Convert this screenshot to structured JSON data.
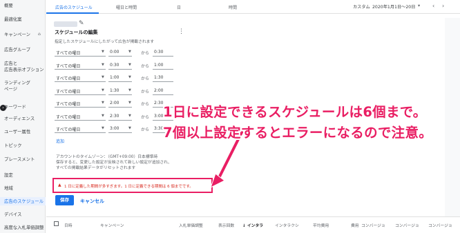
{
  "sidebar": {
    "items": [
      {
        "label": "概要",
        "active": false
      },
      {
        "label": "最適化案",
        "active": false
      },
      {
        "label": "キャンペーン",
        "active": false
      },
      {
        "label": "広告グループ",
        "active": false
      },
      {
        "label": "広告と",
        "active": false
      },
      {
        "label": "広告表示オプション",
        "active": false
      },
      {
        "label": "ランディング",
        "active": false
      },
      {
        "label": "ページ",
        "active": false
      },
      {
        "label": "キーワード",
        "active": false
      },
      {
        "label": "オーディエンス",
        "active": false
      },
      {
        "label": "ユーザー属性",
        "active": false
      },
      {
        "label": "トピック",
        "active": false
      },
      {
        "label": "プレースメント",
        "active": false
      },
      {
        "label": "設定",
        "active": false
      },
      {
        "label": "地域",
        "active": false
      },
      {
        "label": "広告のスケジュール",
        "active": true
      },
      {
        "label": "デバイス",
        "active": false
      },
      {
        "label": "高度な入札単価調整",
        "active": false
      }
    ]
  },
  "tabs": {
    "items": [
      "広告のスケジュール",
      "曜日と時間",
      "日",
      "時間"
    ],
    "active_index": 0
  },
  "date_range": {
    "label": "カスタム",
    "value": "2020年1月1日～20日",
    "caret": "▾",
    "prev": "‹",
    "next": "›"
  },
  "schedule_editor": {
    "title": "スケジュールの編集",
    "description": "指定したスケジュールにしたがって広告が掲載されます",
    "rows": [
      {
        "day": "すべての曜日",
        "start": "0:00",
        "sep": "から",
        "end": "0:30"
      },
      {
        "day": "すべての曜日",
        "start": "0:30",
        "sep": "から",
        "end": "1:00"
      },
      {
        "day": "すべての曜日",
        "start": "1:00",
        "sep": "から",
        "end": "1:30"
      },
      {
        "day": "すべての曜日",
        "start": "1:30",
        "sep": "から",
        "end": "2:00"
      },
      {
        "day": "すべての曜日",
        "start": "2:00",
        "sep": "から",
        "end": "2:30"
      },
      {
        "day": "すべての曜日",
        "start": "2:30",
        "sep": "から",
        "end": "3:00"
      },
      {
        "day": "すべての曜日",
        "start": "3:00",
        "sep": "から",
        "end": "3:30"
      }
    ],
    "add_link": "追加",
    "timezone_note": [
      "アカウントのタイムゾーン：（GMT+09:00）日本標準時",
      "保存すると、変更した設定が反映されて新しい設定が追加され、",
      "すべての掲載結果データがリセットされます"
    ],
    "error": "1 日に定義した期間が多すぎます。1 日に定義できる期間は 6 個までです。",
    "save_label": "保存",
    "cancel_label": "キャンセル"
  },
  "annotation": {
    "line1": "1日に設定できるスケジュールは6個まで。",
    "line2": "7個以上設定するとエラーになるので注意。",
    "color": "#e91e63"
  },
  "table": {
    "headers": [
      "日時",
      "キャンペーン",
      "入札単価調整",
      "表示回数",
      "↓ インタラ",
      "インタラクシ",
      "平均費用",
      "費用",
      "コンバージョ",
      "コンバージョ",
      "コンバージョ"
    ]
  },
  "colors": {
    "accent": "#1a73e8",
    "annotation": "#e91e63",
    "error": "#d93025"
  }
}
